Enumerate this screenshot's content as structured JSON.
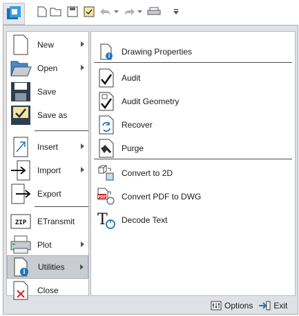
{
  "toolbar": {
    "icons": [
      "app-menu-icon",
      "new-icon",
      "open-icon",
      "save-icon",
      "save-as-icon",
      "undo-icon",
      "redo-icon",
      "plot-icon",
      "customize-icon"
    ]
  },
  "left_menu": {
    "items": [
      {
        "label": "New",
        "icon": "new-document-icon",
        "has_submenu": true
      },
      {
        "label": "Open",
        "icon": "folder-open-icon",
        "has_submenu": true
      },
      {
        "label": "Save",
        "icon": "floppy-disk-icon",
        "has_submenu": false
      },
      {
        "label": "Save as",
        "icon": "save-as-icon",
        "has_submenu": false
      },
      {
        "label": "Insert",
        "icon": "insert-icon",
        "has_submenu": true
      },
      {
        "label": "Import",
        "icon": "import-icon",
        "has_submenu": true
      },
      {
        "label": "Export",
        "icon": "export-icon",
        "has_submenu": false
      },
      {
        "label": "ETransmit",
        "icon": "zip-icon",
        "has_submenu": false
      },
      {
        "label": "Plot",
        "icon": "printer-icon",
        "has_submenu": true
      },
      {
        "label": "Utilities",
        "icon": "utilities-icon",
        "has_submenu": true,
        "active": true
      },
      {
        "label": "Close",
        "icon": "close-document-icon",
        "has_submenu": false
      }
    ]
  },
  "right_menu": {
    "items": [
      {
        "label": "Drawing Properties",
        "icon": "drawing-properties-icon"
      },
      {
        "label": "Audit",
        "icon": "audit-icon"
      },
      {
        "label": "Audit Geometry",
        "icon": "audit-geometry-icon"
      },
      {
        "label": "Recover",
        "icon": "recover-icon"
      },
      {
        "label": "Purge",
        "icon": "purge-icon"
      },
      {
        "label": "Convert to 2D",
        "icon": "convert-2d-icon"
      },
      {
        "label": "Convert PDF to DWG",
        "icon": "pdf-to-dwg-icon"
      },
      {
        "label": "Decode Text",
        "icon": "decode-text-icon"
      }
    ]
  },
  "footer": {
    "options_label": "Options",
    "exit_label": "Exit"
  },
  "colors": {
    "active_bg": "#c9ccd1",
    "accent_blue": "#1e73be",
    "frame": "#dfe1e4"
  }
}
